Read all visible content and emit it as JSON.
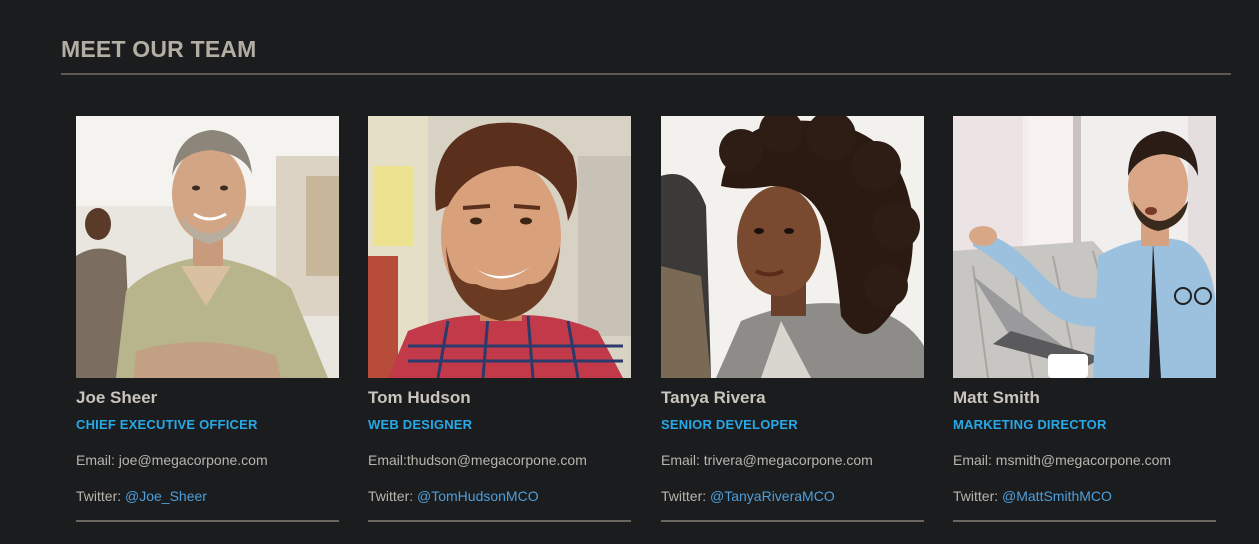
{
  "section": {
    "title": "MEET OUR TEAM"
  },
  "team": [
    {
      "name": "Joe Sheer",
      "role": "CHIEF EXECUTIVE OFFICER",
      "email_label": "Email: joe@megacorpone.com",
      "twitter_label": "Twitter: ",
      "twitter_handle": "@Joe_Sheer"
    },
    {
      "name": "Tom Hudson",
      "role": "WEB DESIGNER",
      "email_label": "Email:thudson@megacorpone.com",
      "twitter_label": "Twitter: ",
      "twitter_handle": "@TomHudsonMCO"
    },
    {
      "name": "Tanya Rivera",
      "role": "SENIOR DEVELOPER",
      "email_label": "Email: trivera@megacorpone.com",
      "twitter_label": "Twitter: ",
      "twitter_handle": "@TanyaRiveraMCO"
    },
    {
      "name": "Matt Smith",
      "role": "MARKETING DIRECTOR",
      "email_label": "Email: msmith@megacorpone.com",
      "twitter_label": "Twitter: ",
      "twitter_handle": "@MattSmithMCO"
    }
  ],
  "colors": {
    "background": "#1b1c1e",
    "heading": "#b3aea3",
    "role_accent": "#27a9e8",
    "link": "#4d9fdb"
  }
}
